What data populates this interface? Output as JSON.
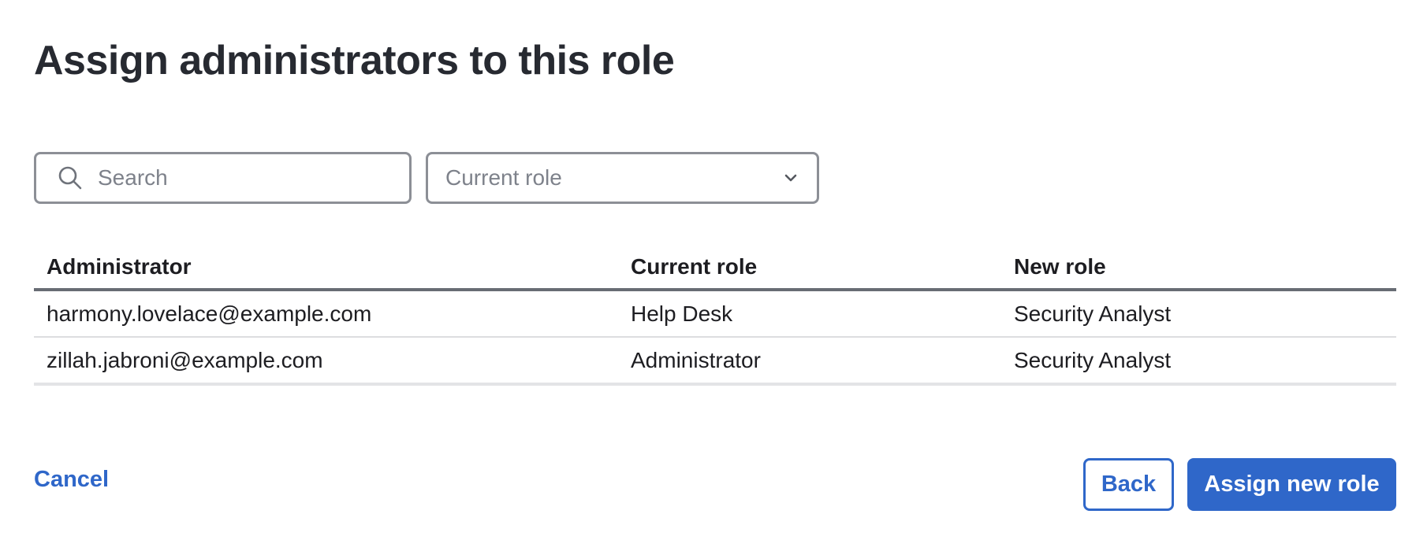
{
  "dialog": {
    "title": "Assign administrators to this role"
  },
  "filters": {
    "search_placeholder": "Search",
    "search_value": "",
    "role_select_label": "Current role"
  },
  "table": {
    "headers": {
      "administrator": "Administrator",
      "current_role": "Current role",
      "new_role": "New role"
    },
    "rows": [
      {
        "administrator": "harmony.lovelace@example.com",
        "current_role": "Help Desk",
        "new_role": "Security Analyst"
      },
      {
        "administrator": "zillah.jabroni@example.com",
        "current_role": "Administrator",
        "new_role": "Security Analyst"
      }
    ]
  },
  "footer": {
    "cancel_label": "Cancel",
    "back_label": "Back",
    "assign_label": "Assign new role"
  },
  "colors": {
    "accent": "#2f67c9",
    "input_border": "#8c8f96",
    "title": "#272a31"
  },
  "icons": {
    "search": "search-icon",
    "dropdown": "chevron-down-icon"
  }
}
